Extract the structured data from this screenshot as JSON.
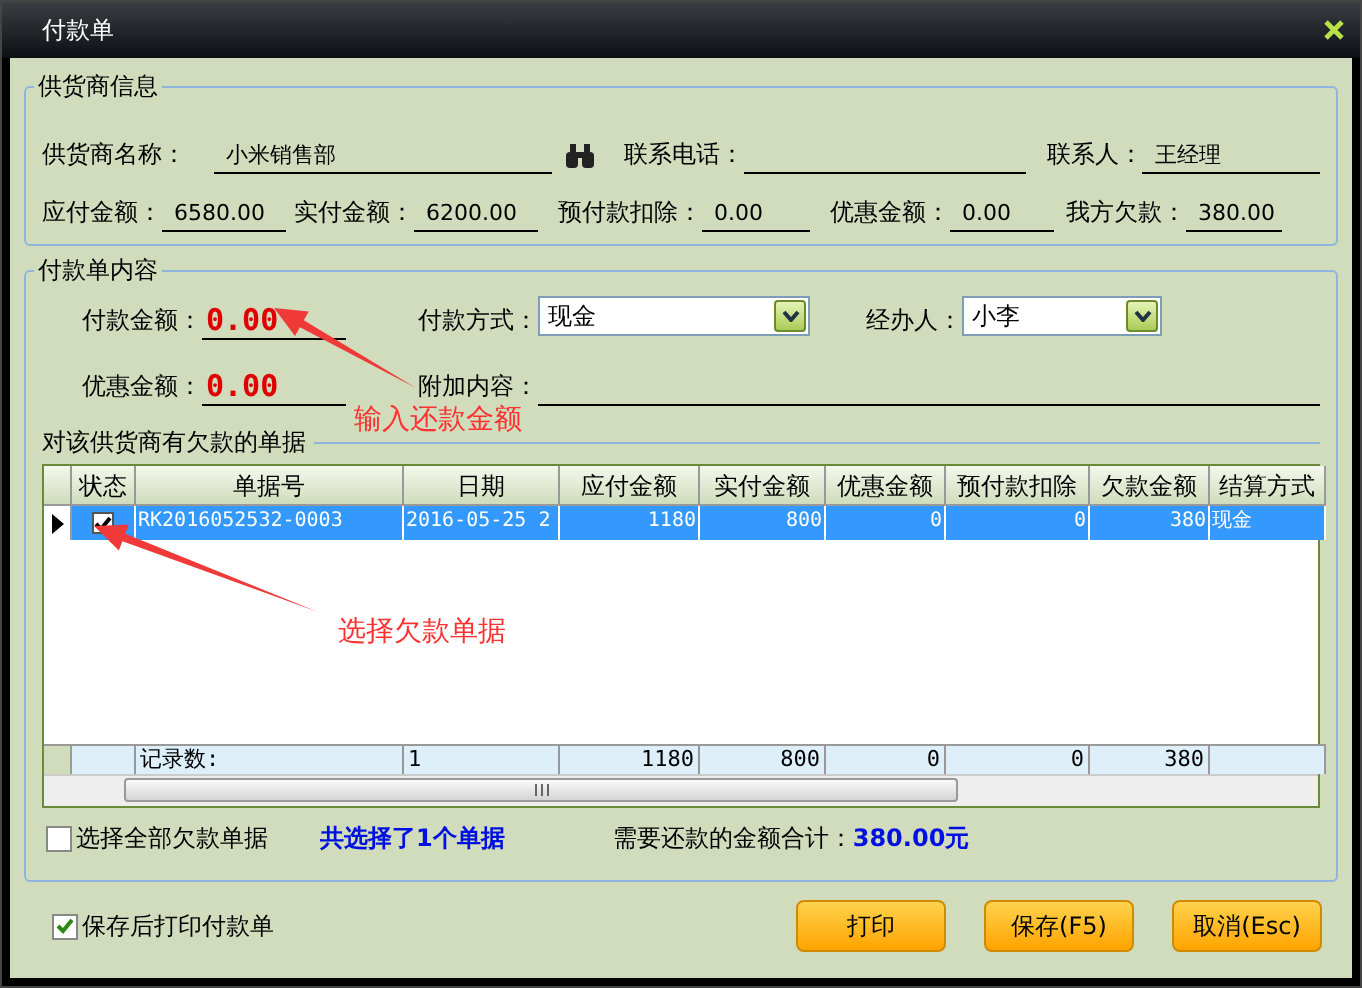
{
  "window": {
    "title": "付款单"
  },
  "supplier_info": {
    "title": "供货商信息",
    "contact_fields": [
      {
        "label": "供货商名称：",
        "value": "小米销售部"
      },
      {
        "label": "联系电话："
      },
      {
        "label": "联系人：",
        "value": "王经理"
      }
    ],
    "amount_fields": [
      {
        "label": "应付金额：",
        "value": "6580.00"
      },
      {
        "label": "实付金额：",
        "value": "6200.00"
      },
      {
        "label": "预付款扣除：",
        "value": "0.00"
      },
      {
        "label": "优惠金额：",
        "value": "0.00"
      },
      {
        "label": "我方欠款：",
        "value": "380.00"
      }
    ]
  },
  "payment": {
    "title": "付款单内容",
    "top_fields": [
      {
        "kind": "amount",
        "label": "付款金额：",
        "value": "0.00"
      },
      {
        "kind": "select",
        "label": "付款方式：",
        "value": "现金"
      },
      {
        "kind": "select",
        "label": "经办人：",
        "value": "小李"
      }
    ],
    "bottom_fields": [
      {
        "kind": "amount",
        "label": "优惠金额：",
        "value": "0.00"
      },
      {
        "kind": "text",
        "label": "附加内容："
      }
    ]
  },
  "table": {
    "title": "对该供货商有欠款的单据",
    "columns": [
      {
        "label": "状态",
        "numeric": false
      },
      {
        "label": "单据号",
        "numeric": false
      },
      {
        "label": "日期",
        "numeric": false
      },
      {
        "label": "应付金额",
        "numeric": true
      },
      {
        "label": "实付金额",
        "numeric": true
      },
      {
        "label": "优惠金额",
        "numeric": true
      },
      {
        "label": "预付款扣除",
        "numeric": true
      },
      {
        "label": "欠款金额",
        "numeric": true
      },
      {
        "label": "结算方式",
        "numeric": false
      }
    ],
    "rows": [
      {
        "selected": true,
        "checked": true,
        "cells": [
          "",
          "RK2016052532-0003",
          "2016-05-25 2",
          "1180",
          "800",
          "0",
          "0",
          "380",
          "现金"
        ]
      }
    ],
    "summary": [
      "记录数:",
      "1",
      "1180",
      "800",
      "0",
      "0",
      "380"
    ]
  },
  "selection": {
    "select_all": {
      "label": "选择全部欠款单据",
      "checked": false
    },
    "count": "共选择了1个单据",
    "total_label": "需要还款的金额合计：",
    "total_value": "380.00元"
  },
  "print_after_save": {
    "label": "保存后打印付款单",
    "checked": true
  },
  "buttons": [
    "打印",
    "保存(F5)",
    "取消(Esc)"
  ],
  "annotations": [
    {
      "text": "输入还款金额"
    },
    {
      "text": "选择欠款单据"
    }
  ]
}
